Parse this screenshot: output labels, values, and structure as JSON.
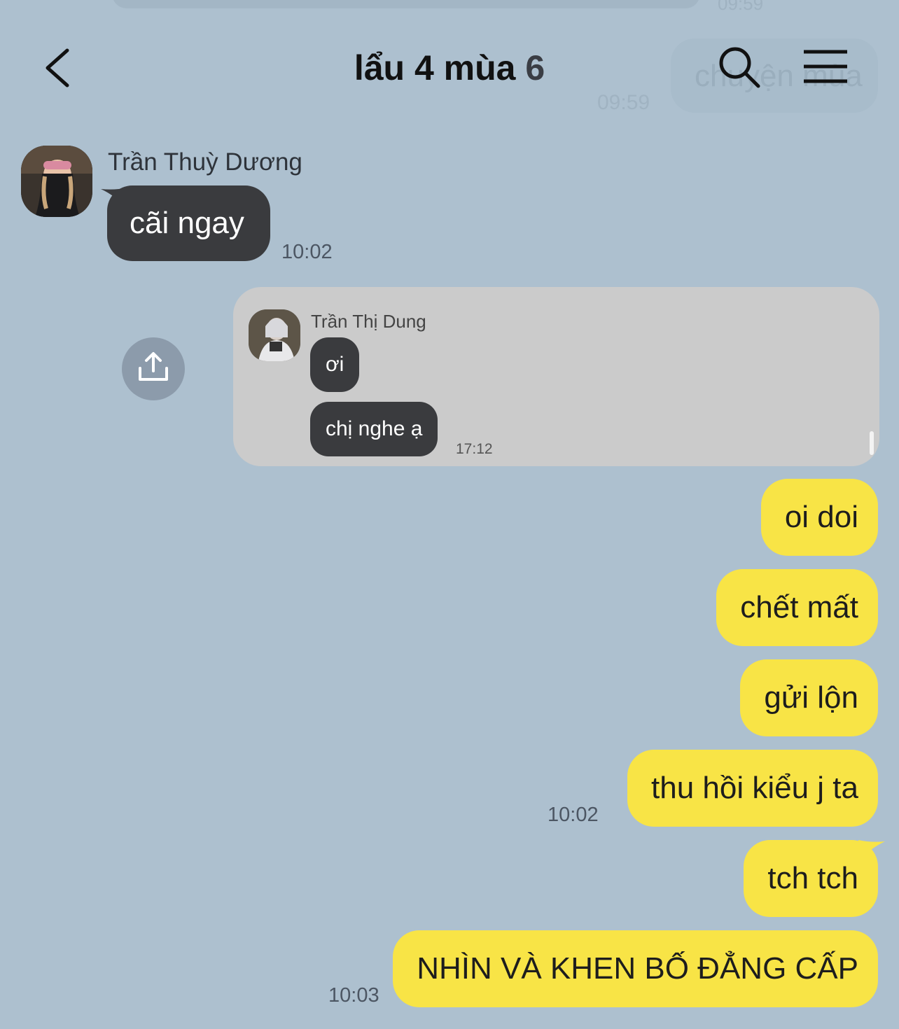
{
  "header": {
    "title": "lẩu 4 mùa",
    "member_count": "6",
    "ghost_bubble_text": "chuyện mùa",
    "ghost_bubble_time": "09:59",
    "ghost_top_time": "09:59"
  },
  "messages": {
    "incoming": {
      "sender": "Trần Thuỳ Dương",
      "text": "cãi ngay",
      "time": "10:02"
    },
    "forwarded": {
      "sender": "Trần Thị Dung",
      "lines": [
        "ơi",
        "chị nghe ạ"
      ],
      "time": "17:12"
    },
    "outgoing": [
      {
        "text": "oi doi"
      },
      {
        "text": "chết mất"
      },
      {
        "text": "gửi lộn"
      },
      {
        "text": "thu hồi kiểu j ta",
        "time": "10:02"
      },
      {
        "text": "tch tch"
      },
      {
        "text": "NHÌN VÀ KHEN BỐ ĐẲNG CẤP",
        "time": "10:03"
      }
    ]
  },
  "colors": {
    "background": "#adc0cf",
    "outgoing_bubble": "#f8e446",
    "incoming_bubble": "#3a3b3e",
    "forward_card": "#cbcbcb"
  },
  "icons": {
    "back": "chevron-left-icon",
    "search": "search-icon",
    "menu": "hamburger-menu-icon",
    "share": "share-upload-icon"
  }
}
